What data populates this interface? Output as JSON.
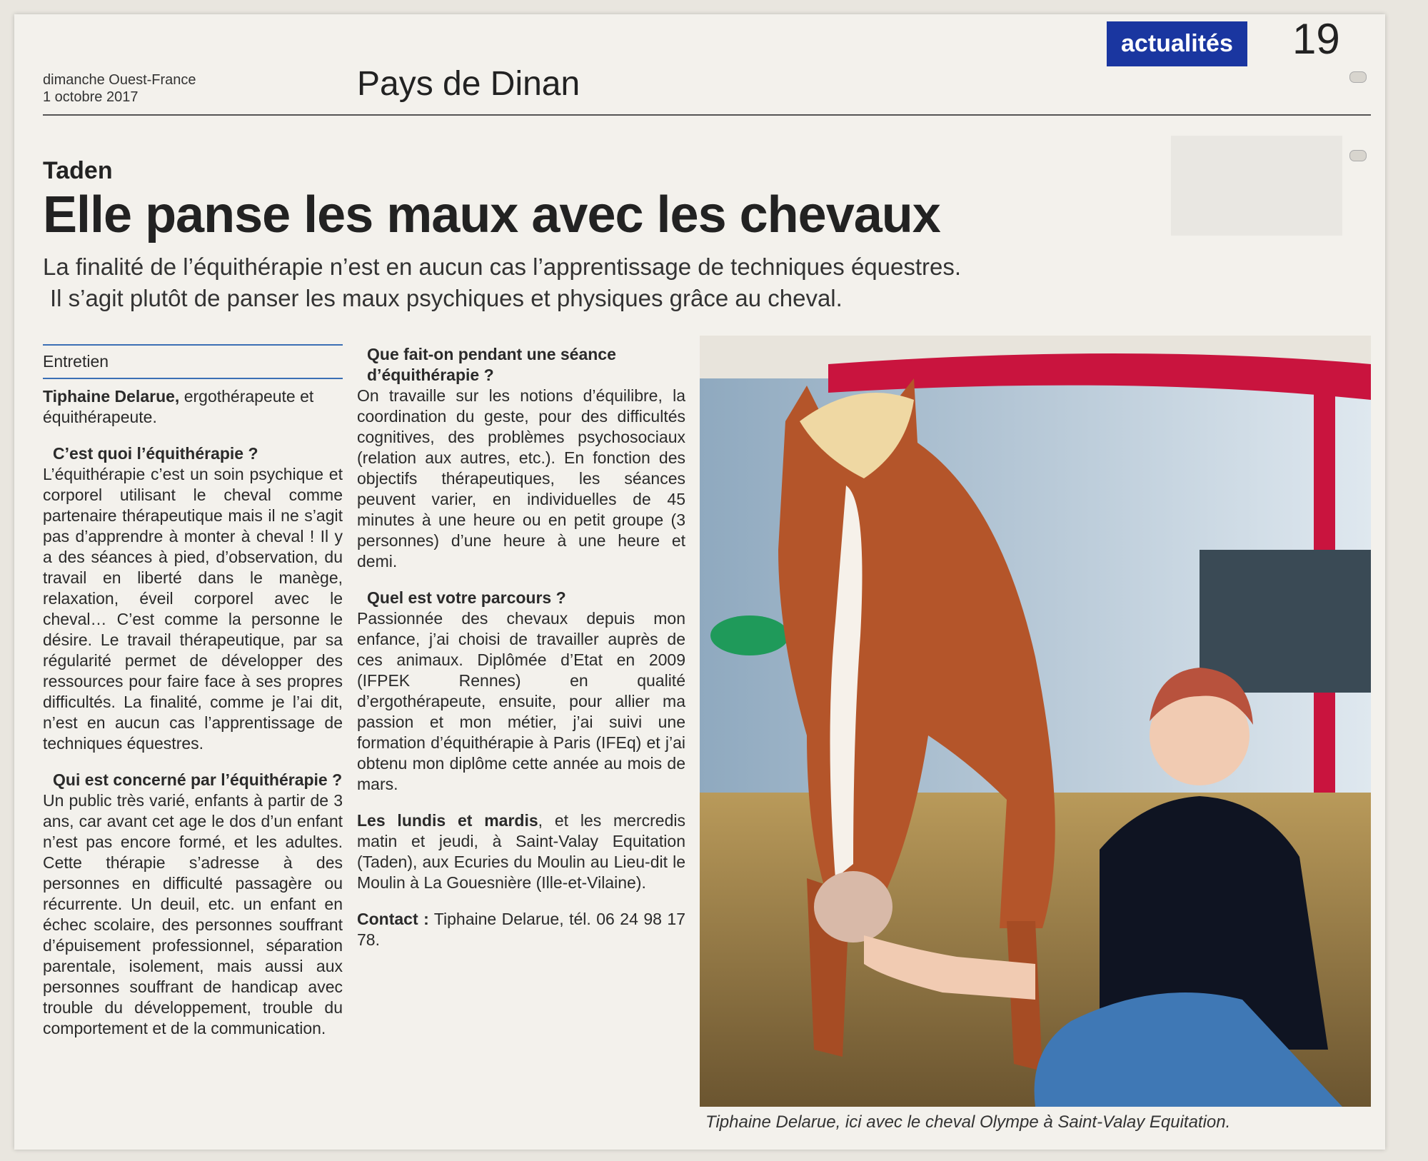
{
  "header": {
    "date_line1": "dimanche Ouest-France",
    "date_line2": "1 octobre 2017",
    "section": "Pays de Dinan",
    "badge": "actualités",
    "page_number": "19"
  },
  "article": {
    "kicker": "Taden",
    "headline": "Elle panse les maux avec les chevaux",
    "chapo_line1": "La finalité de l’équithérapie n’est en aucun cas l’apprentissage de techniques équestres.",
    "chapo_line2": "Il s’agit plutôt de panser les maux psychiques et physiques grâce au cheval.",
    "label": "Entretien",
    "interviewee_name": "Tiphaine Delarue,",
    "interviewee_role": " ergothérapeute et équithérapeute.",
    "q1": "C’est quoi l’équithérapie ?",
    "a1": "L’équithérapie c’est un soin psychique et corporel utilisant le cheval comme partenaire thérapeutique mais il ne s’agit pas d’apprendre à monter à cheval ! Il y a des séances à pied, d’observation, du travail en liberté dans le manège, relaxation, éveil corporel avec le cheval… C’est comme la personne le désire. Le travail thérapeutique, par sa régularité permet de développer des ressources pour faire face à ses propres difficultés. La finalité, comme je l’ai dit, n’est en aucun cas l’apprentissage de techniques équestres.",
    "q2": "Qui est concerné par l’équithérapie ?",
    "a2": "Un public très varié, enfants à partir de 3 ans, car avant cet age le dos d’un enfant n’est pas encore formé, et les adultes. Cette thérapie s’adresse à des personnes en difficulté passagère ou récurrente. Un deuil, etc. un enfant en échec scolaire, des personnes souffrant d’épuisement professionnel, séparation parentale, isolement, mais aussi aux personnes souffrant de handicap avec trouble du développement, trouble du comportement et de la communication.",
    "q3": "Que fait-on pendant une séance d’équithérapie ?",
    "a3": "On travaille sur les notions d’équilibre, la coordination du geste, pour des difficultés cognitives, des problèmes psychosociaux (relation aux autres, etc.). En fonction des objectifs thérapeutiques, les séances peuvent varier, en individuelles de 45 minutes à une heure ou en petit groupe (3 personnes) d’une heure à une heure et demi.",
    "q4": "Quel est votre parcours ?",
    "a4": "Passionnée des chevaux depuis mon enfance, j’ai choisi de travailler auprès de ces animaux. Diplômée d’Etat en 2009 (IFPEK Rennes) en qualité d’ergothérapeute, ensuite, pour allier ma passion et mon métier, j’ai suivi une formation d’équithérapie à Paris (IFEq) et j’ai obtenu mon diplôme cette année au mois de mars.",
    "schedule_bold": "Les lundis et mardis",
    "schedule_rest": ", et les mercredis matin et jeudi, à Saint-Valay Equitation (Taden), aux Ecuries du Moulin au Lieu-dit le Moulin à La Gouesnière (Ille-et-Vilaine).",
    "contact_bold": "Contact :",
    "contact_rest": " Tiphaine Delarue, tél. 06 24 98 17 78.",
    "caption": "Tiphaine Delarue, ici avec le cheval Olympe à Saint-Valay Equitation."
  }
}
